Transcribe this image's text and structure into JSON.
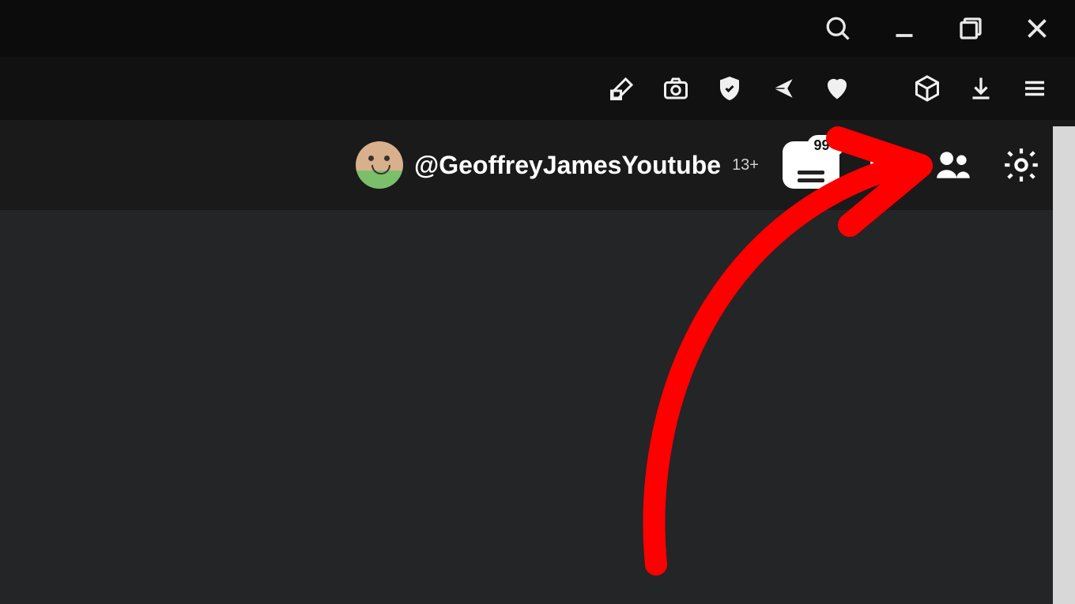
{
  "window_controls": {
    "search": "search",
    "minimize": "minimize",
    "maximize": "maximize",
    "close": "close"
  },
  "toolbar": {
    "edit": "edit",
    "camera": "camera",
    "shield": "shield",
    "send": "send",
    "heart": "heart",
    "cube": "cube",
    "download": "download",
    "menu": "menu"
  },
  "header": {
    "username": "@GeoffreyJamesYoutube",
    "age_badge": "13+",
    "notification_count": "99+"
  },
  "annotation": {
    "type": "arrow",
    "color": "#ff0000",
    "target": "settings-button"
  }
}
